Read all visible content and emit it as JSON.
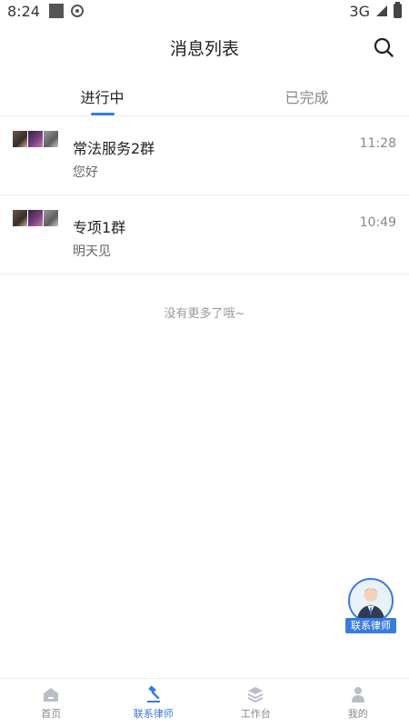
{
  "status_bar": {
    "time": "8:24",
    "network": "3G"
  },
  "header": {
    "title": "消息列表"
  },
  "tabs": [
    {
      "label": "进行中",
      "active": true
    },
    {
      "label": "已完成",
      "active": false
    }
  ],
  "messages": [
    {
      "name": "常法服务2群",
      "time": "11:28",
      "preview": "您好"
    },
    {
      "name": "专项1群",
      "time": "10:49",
      "preview": "明天见"
    }
  ],
  "no_more_text": "没有更多了哦~",
  "fab": {
    "label": "联系律师"
  },
  "bottom_nav": [
    {
      "label": "首页",
      "icon": "home-icon",
      "active": false
    },
    {
      "label": "联系律师",
      "icon": "gavel-icon",
      "active": true
    },
    {
      "label": "工作台",
      "icon": "layers-icon",
      "active": false
    },
    {
      "label": "我的",
      "icon": "user-icon",
      "active": false
    }
  ],
  "colors": {
    "accent": "#3a7be0",
    "inactive": "#888888"
  }
}
